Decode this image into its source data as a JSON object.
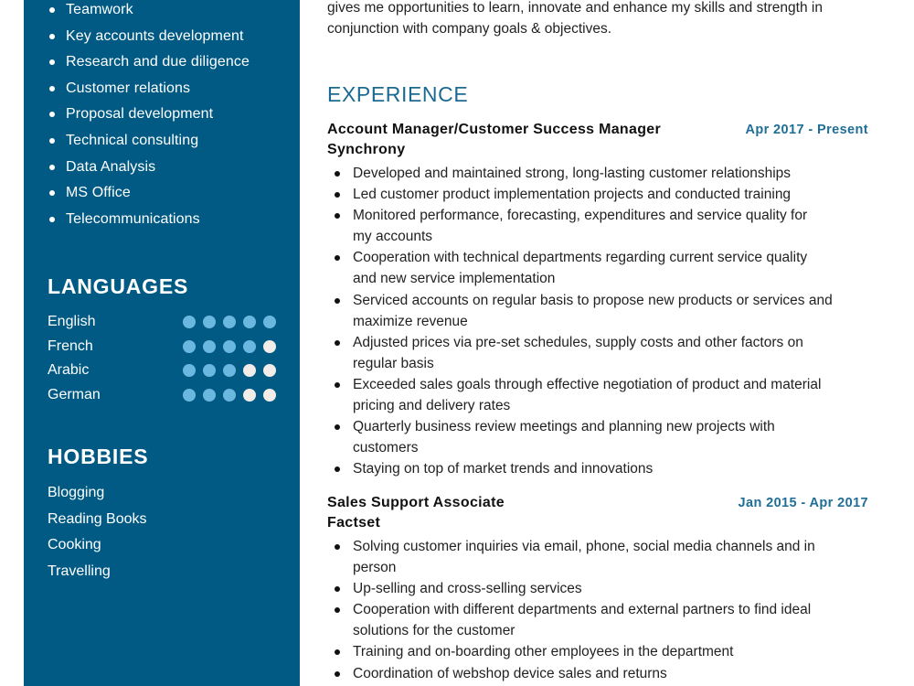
{
  "theme": {
    "sidebar_bg": "#005a84",
    "accent": "#1c6a92",
    "dot_filled": "#6ab8e0",
    "dot_empty": "#f2ede8"
  },
  "sidebar": {
    "skills": [
      "Teamwork",
      "Key accounts development",
      "Research and due diligence",
      "Customer relations",
      "Proposal development",
      "Technical consulting",
      "Data Analysis",
      "MS Office",
      "Telecommunications"
    ],
    "languages_heading": "LANGUAGES",
    "languages": [
      {
        "name": "English",
        "level": 5,
        "max": 5
      },
      {
        "name": "French",
        "level": 4,
        "max": 5
      },
      {
        "name": "Arabic",
        "level": 3,
        "max": 5
      },
      {
        "name": "German",
        "level": 3,
        "max": 5
      }
    ],
    "hobbies_heading": "HOBBIES",
    "hobbies": [
      "Blogging",
      "Reading Books",
      "Cooking",
      "Travelling"
    ]
  },
  "main": {
    "summary_lines": [
      "gives me opportunities to learn, innovate and enhance my skills and strength in",
      "conjunction with company goals & objectives."
    ],
    "experience_heading": "EXPERIENCE",
    "jobs": [
      {
        "title": "Account Manager/Customer Success Manager",
        "company": "Synchrony",
        "dates": "Apr 2017 - Present",
        "bullets": [
          "Developed and maintained strong, long-lasting customer relationships",
          "Led customer product implementation projects and conducted training",
          "Monitored performance, forecasting, expenditures and service quality for my accounts",
          "Cooperation with technical departments regarding current service quality and new service implementation",
          "Serviced accounts on regular basis to propose new products or services and maximize revenue",
          "Adjusted prices via pre-set schedules, supply costs and other factors on regular basis",
          "Exceeded sales goals through effective negotiation of product and material pricing and delivery rates",
          "Quarterly business review meetings and planning new projects with customers",
          "Staying on top of market trends and innovations"
        ]
      },
      {
        "title": "Sales Support Associate",
        "company": "Factset",
        "dates": "Jan 2015 - Apr 2017",
        "bullets": [
          "Solving customer inquiries via email, phone, social media channels and in person",
          "Up-selling and cross-selling services",
          "Cooperation with different departments and external partners to find ideal solutions for the customer",
          "Training and on-boarding other employees in the department",
          "Coordination of webshop device sales and returns"
        ]
      }
    ]
  }
}
